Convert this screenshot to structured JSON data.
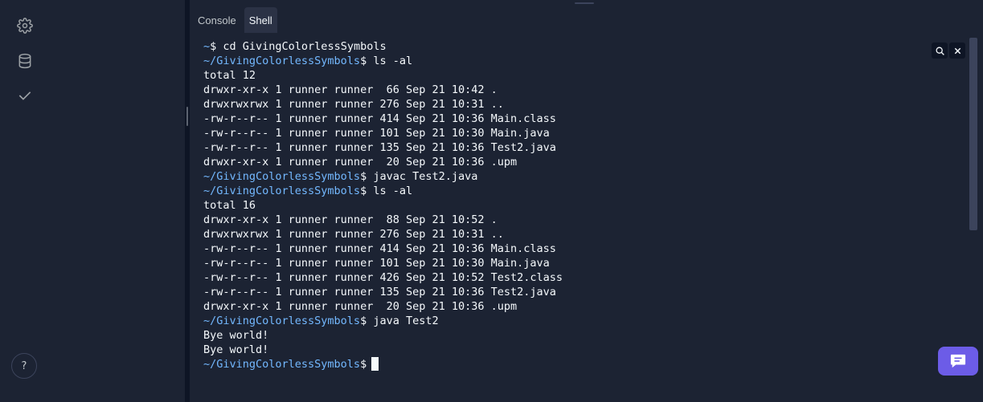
{
  "sidebar": {
    "icons": [
      "gear-icon",
      "database-icon",
      "check-icon"
    ],
    "help_label": "?"
  },
  "tabs": [
    {
      "label": "Console",
      "active": false
    },
    {
      "label": "Shell",
      "active": true
    }
  ],
  "terminal": {
    "lines": [
      {
        "path": "~",
        "text": "$ cd GivingColorlessSymbols"
      },
      {
        "path": "~/GivingColorlessSymbols",
        "text": "$ ls -al"
      },
      {
        "path": "",
        "text": "total 12"
      },
      {
        "path": "",
        "text": "drwxr-xr-x 1 runner runner  66 Sep 21 10:42 ."
      },
      {
        "path": "",
        "text": "drwxrwxrwx 1 runner runner 276 Sep 21 10:31 .."
      },
      {
        "path": "",
        "text": "-rw-r--r-- 1 runner runner 414 Sep 21 10:36 Main.class"
      },
      {
        "path": "",
        "text": "-rw-r--r-- 1 runner runner 101 Sep 21 10:30 Main.java"
      },
      {
        "path": "",
        "text": "-rw-r--r-- 1 runner runner 135 Sep 21 10:36 Test2.java"
      },
      {
        "path": "",
        "text": "drwxr-xr-x 1 runner runner  20 Sep 21 10:36 .upm"
      },
      {
        "path": "~/GivingColorlessSymbols",
        "text": "$ javac Test2.java"
      },
      {
        "path": "~/GivingColorlessSymbols",
        "text": "$ ls -al"
      },
      {
        "path": "",
        "text": "total 16"
      },
      {
        "path": "",
        "text": "drwxr-xr-x 1 runner runner  88 Sep 21 10:52 ."
      },
      {
        "path": "",
        "text": "drwxrwxrwx 1 runner runner 276 Sep 21 10:31 .."
      },
      {
        "path": "",
        "text": "-rw-r--r-- 1 runner runner 414 Sep 21 10:36 Main.class"
      },
      {
        "path": "",
        "text": "-rw-r--r-- 1 runner runner 101 Sep 21 10:30 Main.java"
      },
      {
        "path": "",
        "text": "-rw-r--r-- 1 runner runner 426 Sep 21 10:52 Test2.class"
      },
      {
        "path": "",
        "text": "-rw-r--r-- 1 runner runner 135 Sep 21 10:36 Test2.java"
      },
      {
        "path": "",
        "text": "drwxr-xr-x 1 runner runner  20 Sep 21 10:36 .upm"
      },
      {
        "path": "~/GivingColorlessSymbols",
        "text": "$ java Test2"
      },
      {
        "path": "",
        "text": "Bye world!"
      },
      {
        "path": "",
        "text": "Bye world!"
      },
      {
        "path": "~/GivingColorlessSymbols",
        "text": "$",
        "cursor": true
      }
    ],
    "tools": [
      "search-icon",
      "close-icon"
    ]
  },
  "chat_fab": {
    "icon": "chat-icon"
  },
  "colors": {
    "background": "#0e1525",
    "surface": "#1c2333",
    "prompt_path": "#73b8ff",
    "text": "#f5f9fc",
    "accent": "#6c5ce7"
  }
}
